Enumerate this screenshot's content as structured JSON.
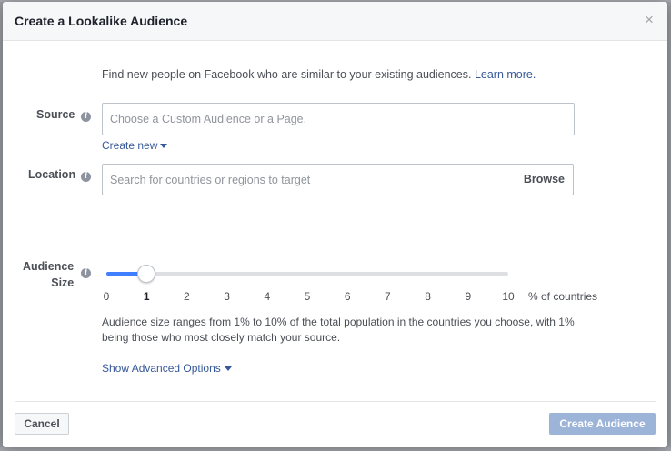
{
  "dialog": {
    "title": "Create a Lookalike Audience",
    "close_glyph": "×"
  },
  "intro": {
    "text": "Find new people on Facebook who are similar to your existing audiences. ",
    "link": "Learn more."
  },
  "source": {
    "label": "Source",
    "placeholder": "Choose a Custom Audience or a Page.",
    "create_new": "Create new"
  },
  "location": {
    "label": "Location",
    "placeholder": "Search for countries or regions to target",
    "browse": "Browse"
  },
  "audience_size": {
    "label_line1": "Audience",
    "label_line2": "Size",
    "selected": 1,
    "min": 0,
    "max": 10,
    "ticks": [
      "0",
      "1",
      "2",
      "3",
      "4",
      "5",
      "6",
      "7",
      "8",
      "9",
      "10"
    ],
    "unit_label": "% of countries",
    "help": "Audience size ranges from 1% to 10% of the total population in the countries you choose, with 1% being those who most closely match your source.",
    "advanced": "Show Advanced Options"
  },
  "footer": {
    "cancel": "Cancel",
    "create": "Create Audience"
  },
  "colors": {
    "link": "#365899",
    "slider_fill": "#4080ff",
    "primary_disabled": "#9cb4d8"
  },
  "icons": {
    "info": "info-icon",
    "close": "close-icon",
    "caret": "caret-down-icon"
  }
}
